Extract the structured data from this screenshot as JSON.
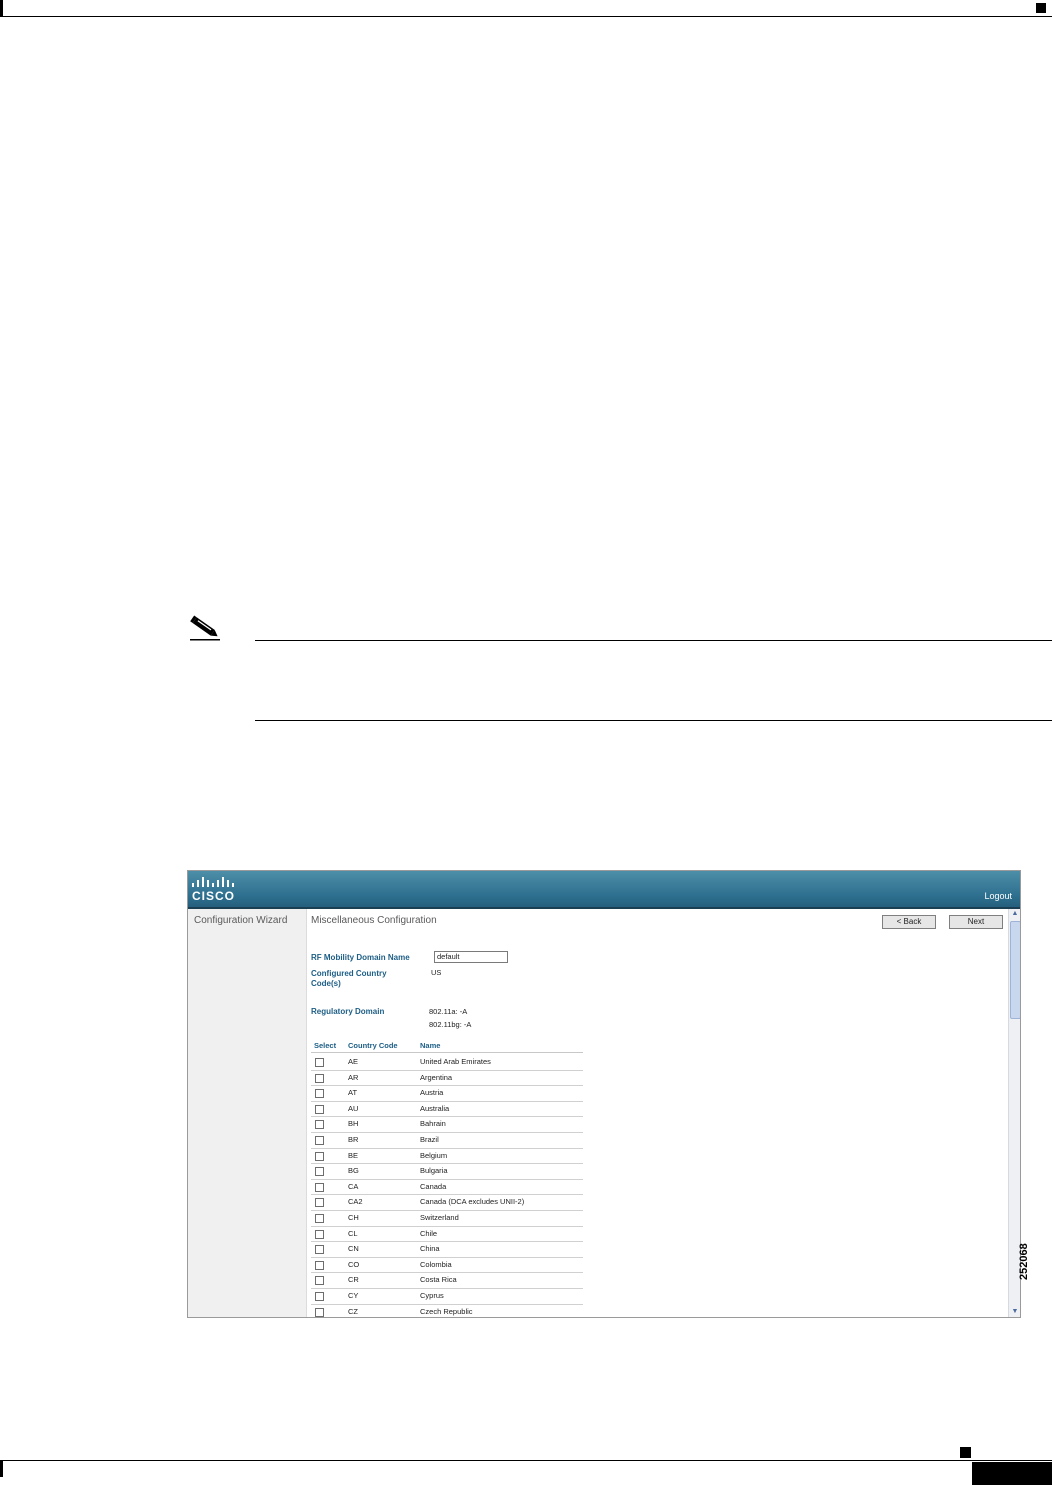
{
  "app": {
    "logo_text": "CISCO",
    "logout_label": "Logout",
    "sidebar_title": "Configuration Wizard",
    "page_title": "Miscellaneous Configuration",
    "back_label": "< Back",
    "next_label": "Next"
  },
  "form": {
    "rf_label": "RF Mobility Domain Name",
    "rf_value": "default",
    "country_label_line1": "Configured Country",
    "country_label_line2": "Code(s)",
    "country_value": "US",
    "regdom_label": "Regulatory Domain",
    "regdom_a": "802.11a:  -A",
    "regdom_bg": "802.11bg:  -A"
  },
  "table": {
    "headers": [
      "Select",
      "Country Code",
      "Name"
    ],
    "rows": [
      {
        "code": "AE",
        "name": "United Arab Emirates"
      },
      {
        "code": "AR",
        "name": "Argentina"
      },
      {
        "code": "AT",
        "name": "Austria"
      },
      {
        "code": "AU",
        "name": "Australia"
      },
      {
        "code": "BH",
        "name": "Bahrain"
      },
      {
        "code": "BR",
        "name": "Brazil"
      },
      {
        "code": "BE",
        "name": "Belgium"
      },
      {
        "code": "BG",
        "name": "Bulgaria"
      },
      {
        "code": "CA",
        "name": "Canada"
      },
      {
        "code": "CA2",
        "name": "Canada (DCA excludes UNII-2)"
      },
      {
        "code": "CH",
        "name": "Switzerland"
      },
      {
        "code": "CL",
        "name": "Chile"
      },
      {
        "code": "CN",
        "name": "China"
      },
      {
        "code": "CO",
        "name": "Colombia"
      },
      {
        "code": "CR",
        "name": "Costa Rica"
      },
      {
        "code": "CY",
        "name": "Cyprus"
      },
      {
        "code": "CZ",
        "name": "Czech Republic"
      }
    ]
  },
  "figure_id": "252068"
}
